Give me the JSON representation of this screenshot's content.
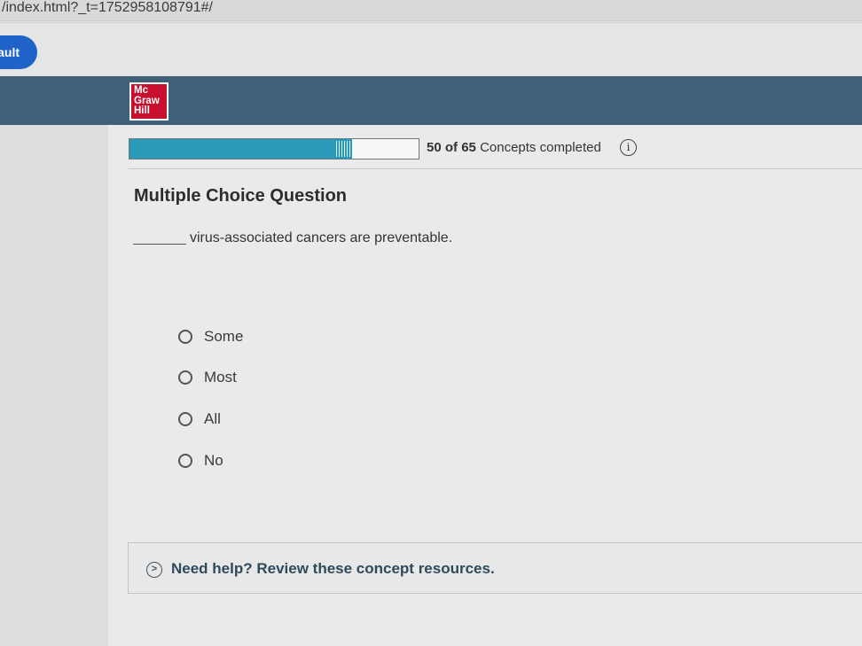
{
  "browser": {
    "url": "/index.html?_t=1752958108791#/"
  },
  "toolbar": {
    "button_label": "ault"
  },
  "header": {
    "logo_lines": [
      "Mc",
      "Graw",
      "Hill"
    ]
  },
  "progress": {
    "completed": 50,
    "total": 65,
    "completed_label": "50",
    "of_label": "of",
    "total_label": "65",
    "suffix": "Concepts completed",
    "fill_color": "#2b9ab8",
    "info_icon": "info-icon"
  },
  "question": {
    "type_label": "Multiple Choice Question",
    "text": "virus-associated cancers are preventable."
  },
  "options": [
    {
      "label": "Some",
      "selected": false
    },
    {
      "label": "Most",
      "selected": false
    },
    {
      "label": "All",
      "selected": false
    },
    {
      "label": "No",
      "selected": false
    }
  ],
  "help": {
    "icon": "chevron-right-circle-icon",
    "text": "Need help? Review these concept resources."
  },
  "colors": {
    "header_bg": "#3e6177",
    "logo_red": "#c8102e",
    "pill_blue": "#1f63c8"
  }
}
